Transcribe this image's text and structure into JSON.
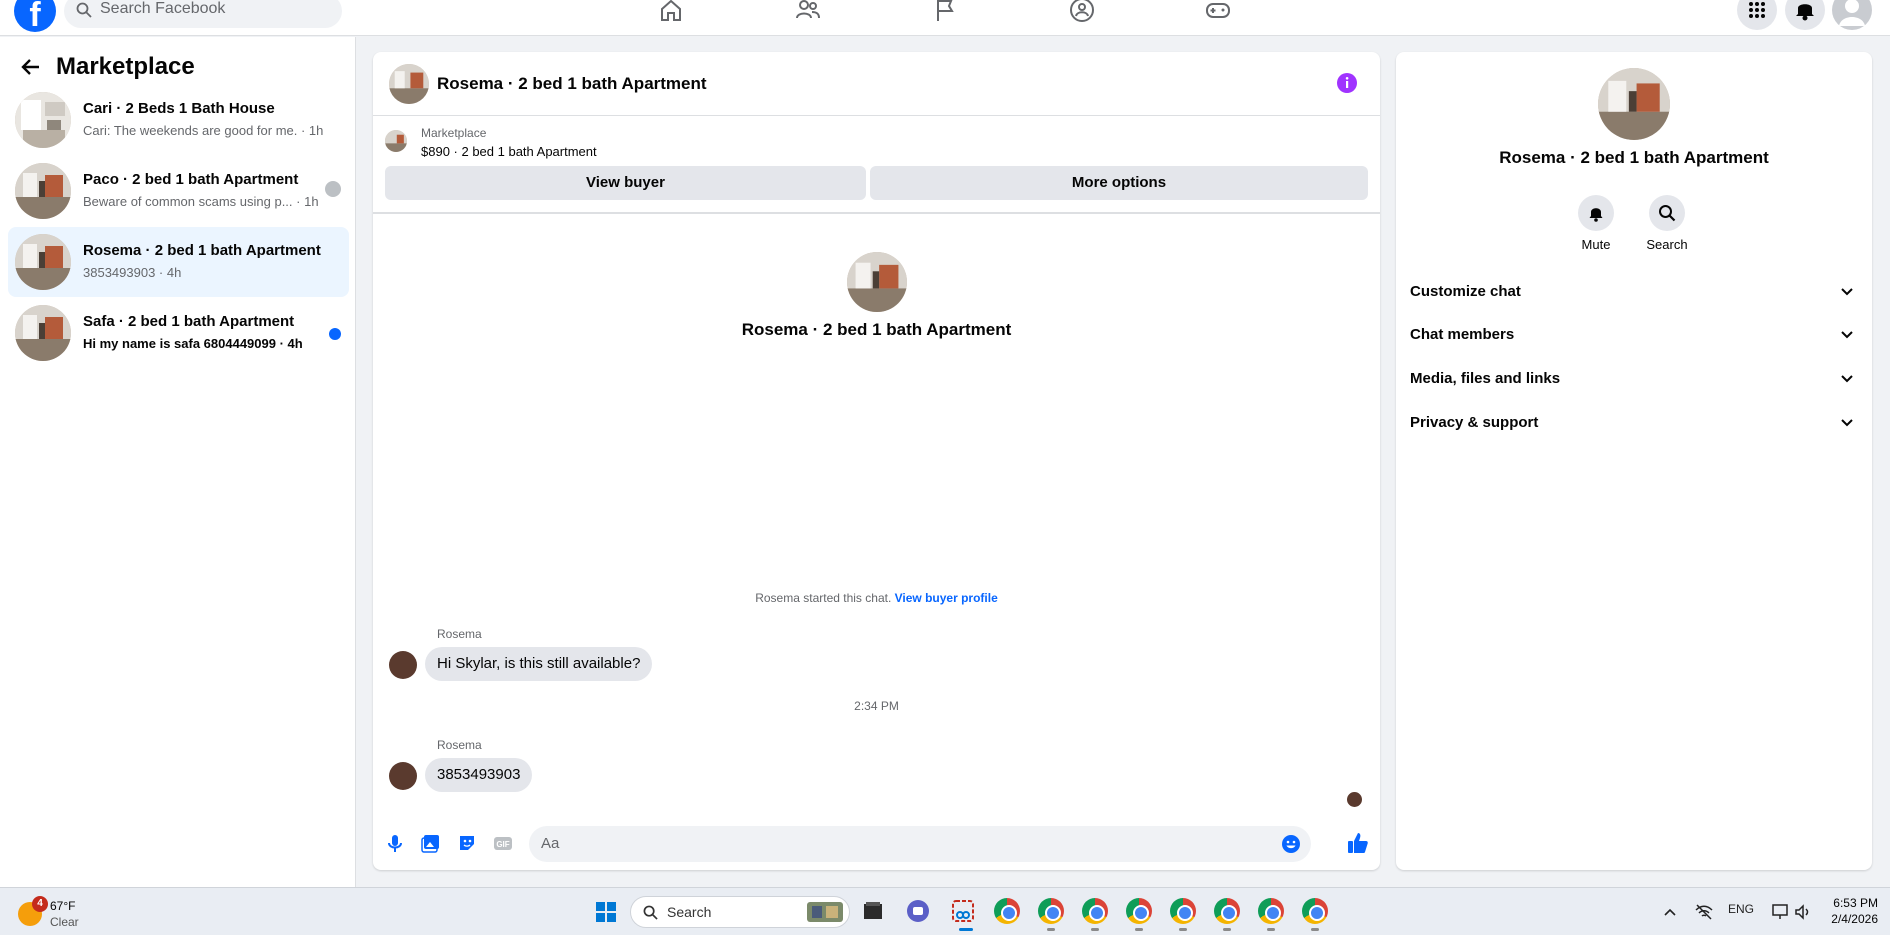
{
  "topbar": {
    "logo_letter": "f",
    "search_placeholder": "Search Facebook"
  },
  "sidebar": {
    "title": "Marketplace",
    "threads": [
      {
        "title": "Cari · 2 Beds 1 Bath House",
        "subtitle": "Cari: The weekends are good for me. · 1h",
        "unread": false
      },
      {
        "title": "Paco · 2 bed 1 bath Apartment",
        "subtitle": "Beware of common scams using p... · 1h",
        "unread": false
      },
      {
        "title": "Rosema · 2 bed 1 bath Apartment",
        "subtitle": "3853493903 · 4h",
        "unread": false,
        "active": true
      },
      {
        "title": "Safa · 2 bed 1 bath Apartment",
        "subtitle": "Hi my name is safa 6804449099 · 4h",
        "unread": true
      }
    ]
  },
  "chat": {
    "header_name": "Rosema · 2 bed 1 bath Apartment",
    "marketplace_label": "Marketplace",
    "listing": "$890 · 2 bed 1 bath Apartment",
    "view_buyer_label": "View buyer",
    "more_options_label": "More options",
    "hero_name": "Rosema · 2 bed 1 bath Apartment",
    "started_text": "Rosema started this chat.",
    "view_profile_link": "View buyer profile",
    "messages": [
      {
        "sender": "Rosema",
        "text": "Hi Skylar, is this still available?"
      },
      {
        "sender": "Rosema",
        "text": "3853493903"
      }
    ],
    "timestamp": "2:34 PM",
    "composer_placeholder": "Aa"
  },
  "right_panel": {
    "name": "Rosema · 2 bed 1 bath Apartment",
    "mute_label": "Mute",
    "search_label": "Search",
    "sections": [
      "Customize chat",
      "Chat members",
      "Media, files and links",
      "Privacy & support"
    ]
  },
  "taskbar": {
    "weather_badge": "4",
    "temperature": "67°F",
    "condition": "Clear",
    "search_label": "Search",
    "lang": "ENG",
    "time": "6:53 PM",
    "date": "2/4/2026"
  },
  "colors": {
    "accent": "#0866ff",
    "info": "#a033ff",
    "bubble": "#e4e6eb",
    "active_thread": "#ebf5ff"
  }
}
